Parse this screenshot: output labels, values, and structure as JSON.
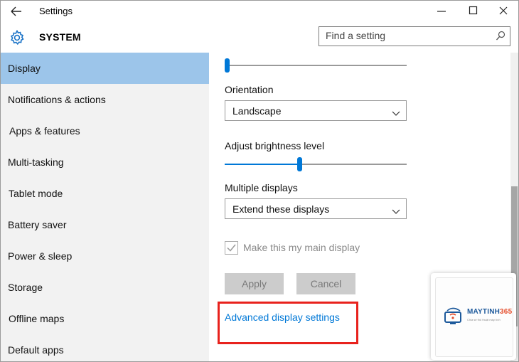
{
  "window": {
    "title": "Settings",
    "back_icon": "back-arrow-icon",
    "controls": [
      "minimize-icon",
      "maximize-icon",
      "close-icon"
    ]
  },
  "header": {
    "section": "SYSTEM",
    "section_icon": "gear-icon",
    "search_placeholder": "Find a setting"
  },
  "sidebar": {
    "items": [
      {
        "label": "Display",
        "active": true
      },
      {
        "label": "Notifications & actions"
      },
      {
        "label": "Apps & features"
      },
      {
        "label": "Multi-tasking"
      },
      {
        "label": "Tablet mode"
      },
      {
        "label": "Battery saver"
      },
      {
        "label": "Power & sleep"
      },
      {
        "label": "Storage"
      },
      {
        "label": "Offline maps"
      },
      {
        "label": "Default apps"
      }
    ]
  },
  "main": {
    "top_slider_value": 0,
    "orientation": {
      "label": "Orientation",
      "value": "Landscape"
    },
    "brightness": {
      "label": "Adjust brightness level",
      "value": 0.4
    },
    "multiple_displays": {
      "label": "Multiple displays",
      "value": "Extend these displays"
    },
    "main_display_checkbox": {
      "label": "Make this my main display",
      "checked": true,
      "disabled": true
    },
    "apply_label": "Apply",
    "cancel_label": "Cancel",
    "advanced_link": "Advanced display settings"
  },
  "colors": {
    "accent": "#0078d7",
    "active_nav": "#9cc5ea",
    "highlight": "#e8221d"
  },
  "watermark": {
    "brand_prefix": "MAYTINH",
    "brand_suffix": "365",
    "tagline": "Chia sẻ thủ thuật máy tính"
  }
}
